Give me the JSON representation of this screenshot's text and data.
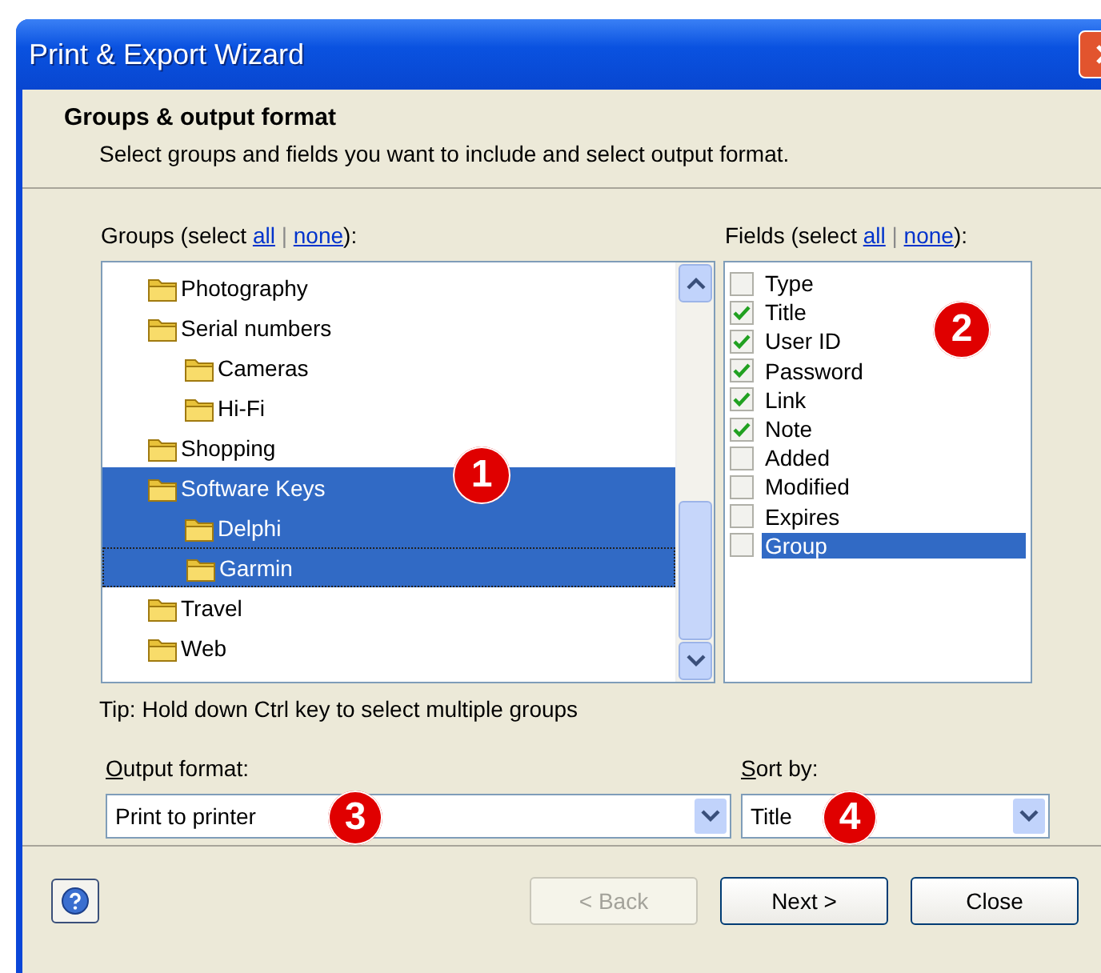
{
  "window": {
    "title": "Print & Export Wizard"
  },
  "header": {
    "title": "Groups & output format",
    "subtitle": "Select groups and fields you want to include and select output format."
  },
  "groups": {
    "label_start": "Groups (select",
    "all_link": "all",
    "separator": "|",
    "none_link": "none",
    "label_end": "):",
    "tree": [
      {
        "label": "Photography",
        "selected": false,
        "focused": false
      },
      {
        "label": "Serial numbers",
        "selected": false,
        "focused": false,
        "children": [
          {
            "label": "Cameras",
            "selected": false,
            "focused": false
          },
          {
            "label": "Hi-Fi",
            "selected": false,
            "focused": false
          }
        ]
      },
      {
        "label": "Shopping",
        "selected": false,
        "focused": false
      },
      {
        "label": "Software Keys",
        "selected": true,
        "focused": false,
        "children": [
          {
            "label": "Delphi",
            "selected": true,
            "focused": false
          },
          {
            "label": "Garmin",
            "selected": true,
            "focused": true
          }
        ]
      },
      {
        "label": "Travel",
        "selected": false,
        "focused": false
      },
      {
        "label": "Web",
        "selected": false,
        "focused": false
      }
    ]
  },
  "fields": {
    "label_start": "Fields (select",
    "all_link": "all",
    "separator": "|",
    "none_link": "none",
    "label_end": "):",
    "items": [
      {
        "label": "Type",
        "checked": false,
        "selected": false
      },
      {
        "label": "Title",
        "checked": true,
        "selected": false
      },
      {
        "label": "User ID",
        "checked": true,
        "selected": false
      },
      {
        "label": "Password",
        "checked": true,
        "selected": false
      },
      {
        "label": "Link",
        "checked": true,
        "selected": false
      },
      {
        "label": "Note",
        "checked": true,
        "selected": false
      },
      {
        "label": "Added",
        "checked": false,
        "selected": false
      },
      {
        "label": "Modified",
        "checked": false,
        "selected": false
      },
      {
        "label": "Expires",
        "checked": false,
        "selected": false
      },
      {
        "label": "Group",
        "checked": false,
        "selected": true
      }
    ]
  },
  "tip": "Tip: Hold down Ctrl key to select multiple groups",
  "output_format": {
    "label": "Output format:",
    "value": "Print to printer"
  },
  "sort_by": {
    "label": "Sort by:",
    "value": "Title"
  },
  "callouts": [
    "1",
    "2",
    "3",
    "4"
  ],
  "buttons": [
    {
      "label": "< Back",
      "disabled": true
    },
    {
      "label": "Next >",
      "disabled": false
    },
    {
      "label": "Close",
      "disabled": false
    }
  ]
}
